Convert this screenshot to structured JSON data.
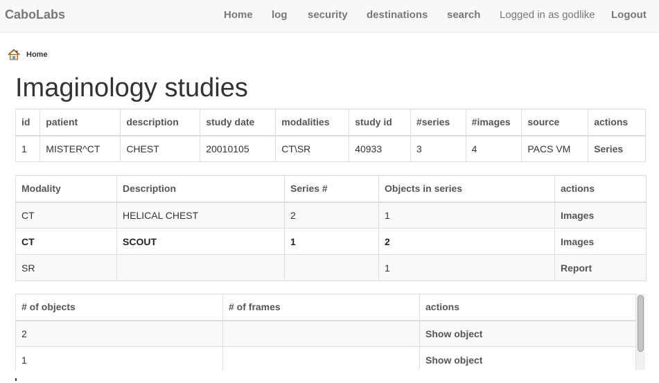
{
  "navbar": {
    "brand": "CaboLabs",
    "items": [
      {
        "label": "Home"
      },
      {
        "label": "log"
      },
      {
        "label": "security"
      },
      {
        "label": "destinations"
      },
      {
        "label": "search"
      }
    ],
    "user_text": "Logged in as godlike",
    "logout_label": "Logout"
  },
  "breadcrumb": {
    "icon": "home-icon",
    "label": "Home"
  },
  "page_title": "Imaginology studies",
  "studies_table": {
    "headers": [
      "id",
      "patient",
      "description",
      "study date",
      "modalities",
      "study id",
      "#series",
      "#images",
      "source",
      "actions"
    ],
    "rows": [
      {
        "id": "1",
        "patient": "MISTER^CT",
        "description": "CHEST",
        "study_date": "20010105",
        "modalities": "CT\\SR",
        "study_id": "40933",
        "series": "3",
        "images": "4",
        "source": "PACS VM",
        "action": "Series"
      }
    ]
  },
  "series_table": {
    "headers": [
      "Modality",
      "Description",
      "Series #",
      "Objects in series",
      "actions"
    ],
    "rows": [
      {
        "modality": "CT",
        "description": "HELICAL CHEST",
        "series_no": "2",
        "objects": "1",
        "action": "Images"
      },
      {
        "modality": "CT",
        "description": "SCOUT",
        "series_no": "1",
        "objects": "2",
        "action": "Images"
      },
      {
        "modality": "SR",
        "description": "",
        "series_no": "",
        "objects": "1",
        "action": "Report"
      }
    ]
  },
  "objects_table": {
    "headers": [
      "# of objects",
      "# of frames",
      "actions"
    ],
    "rows": [
      {
        "objects": "2",
        "frames": "",
        "action": "Show object"
      },
      {
        "objects": "1",
        "frames": "",
        "action": "Show object"
      }
    ]
  },
  "colors": {
    "navbar_bg": "#f8f8f8",
    "nav_text": "#777777",
    "border": "#dddddd",
    "stripe": "#f9f9f9"
  }
}
